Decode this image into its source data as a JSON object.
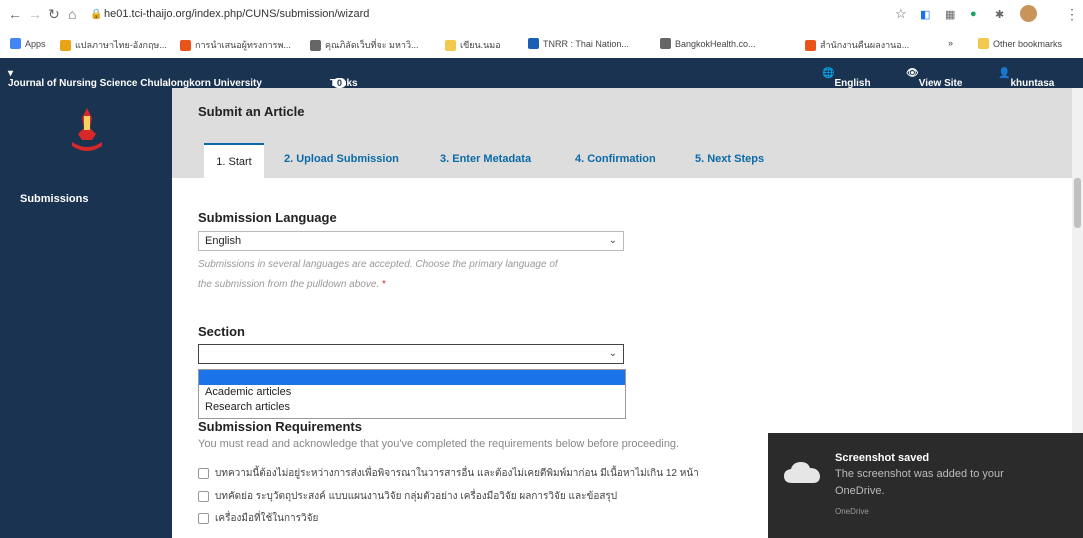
{
  "browser": {
    "url": "he01.tci-thaijo.org/index.php/CUNS/submission/wizard",
    "bookmarks": [
      {
        "label": "Apps",
        "color": "#4285f4"
      },
      {
        "label": "แปลภาษาไทย-อังกฤษ...",
        "color": "#e8a317"
      },
      {
        "label": "การนำเสนอผู้ทรงการพ...",
        "color": "#e8541a"
      },
      {
        "label": "คุณภิลัดเว็บที่จะ มหาวิ...",
        "color": "#666666"
      },
      {
        "label": "เขียน.นมอ",
        "color": "#f2c94c"
      },
      {
        "label": "TNRR : Thai Nation...",
        "color": "#1a5fb4"
      },
      {
        "label": "BangkokHealth.co...",
        "color": "#666666"
      },
      {
        "label": "สำนักงานคืนผลงานอ...",
        "color": "#e8541a"
      }
    ],
    "overflow": "»",
    "other_bookmarks": "Other bookmarks"
  },
  "header": {
    "journal": "Journal of Nursing Science Chulalongkorn University",
    "tasks_label": "Tasks",
    "tasks_count": "0",
    "language": "English",
    "view_site": "View Site",
    "user": "khuntasa",
    "bg_color": "#1a3350"
  },
  "sidebar": {
    "item": "Submissions"
  },
  "page": {
    "title": "Submit an Article",
    "tabs": [
      "1. Start",
      "2. Upload Submission",
      "3. Enter Metadata",
      "4. Confirmation",
      "5. Next Steps"
    ],
    "language_label": "Submission Language",
    "language_value": "English",
    "language_help1": "Submissions in several languages are accepted. Choose the primary language of",
    "language_help2": "the submission from the pulldown above.",
    "required_mark": "*",
    "section_label": "Section",
    "section_value": "",
    "section_options": [
      "",
      "Academic articles",
      "Research articles"
    ],
    "requirements_title": "Submission Requirements",
    "requirements_help": "You must read and acknowledge that you've completed the requirements below before proceeding.",
    "requirements": [
      "บทความนี้ต้องไม่อยู่ระหว่างการส่งเพื่อพิจารณาในวารสารอื่น และต้องไม่เคยตีพิมพ์มาก่อน มีเนื้อหาไม่เกิน 12 หน้า",
      "บทคัดย่อ ระบุวัตถุประสงค์ แบบแผนงานวิจัย กลุ่มตัวอย่าง เครื่องมือวิจัย ผลการวิจัย และข้อสรุป",
      "เครื่องมือที่ใช้ในการวิจัย"
    ]
  },
  "toast": {
    "title": "Screenshot saved",
    "body1": "The screenshot was added to your",
    "body2": "OneDrive.",
    "source": "OneDrive"
  }
}
